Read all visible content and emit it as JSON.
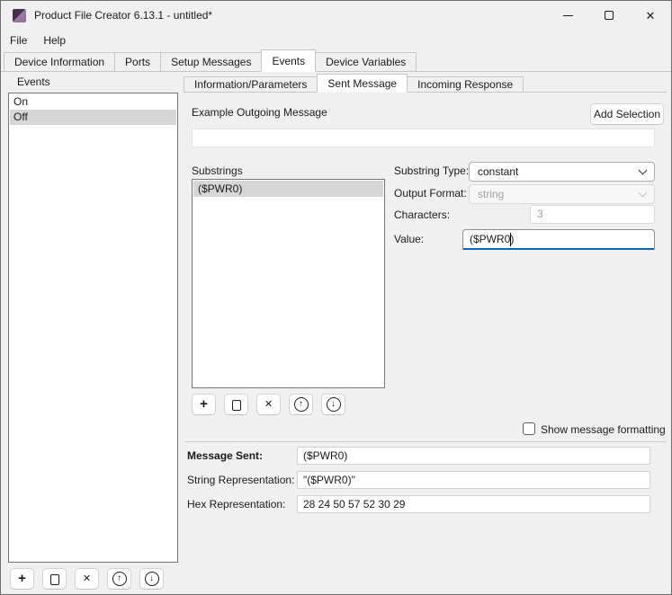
{
  "window": {
    "title": "Product File Creator 6.13.1 - untitled*"
  },
  "icons": {
    "close": "✕",
    "add": "+",
    "delete": "✕",
    "move_up": "↑",
    "move_down": "↓"
  },
  "menu": {
    "items": [
      {
        "label": "File"
      },
      {
        "label": "Help"
      }
    ]
  },
  "main_tabs": {
    "active": "Events",
    "items": [
      {
        "label": "Device Information"
      },
      {
        "label": "Ports"
      },
      {
        "label": "Setup Messages"
      },
      {
        "label": "Events"
      },
      {
        "label": "Device Variables"
      }
    ]
  },
  "events_panel": {
    "label": "Events",
    "items": [
      {
        "label": "On",
        "selected": false
      },
      {
        "label": "Off",
        "selected": true
      }
    ]
  },
  "detail_tabs": {
    "active": "Sent Message",
    "items": [
      {
        "label": "Information/Parameters"
      },
      {
        "label": "Sent Message"
      },
      {
        "label": "Incoming Response"
      }
    ]
  },
  "sent_message_tab": {
    "example_outgoing_message": {
      "label": "Example Outgoing Message",
      "value": ""
    },
    "add_selection_button": "Add Selection",
    "substrings": {
      "label": "Substrings",
      "items": [
        {
          "label": "($PWR0)",
          "selected": true
        }
      ]
    },
    "substring_type": {
      "label": "Substring Type:",
      "value": "constant",
      "enabled": true
    },
    "output_format": {
      "label": "Output Format:",
      "value": "string",
      "enabled": false
    },
    "characters": {
      "label": "Characters:",
      "value": "3",
      "enabled": false
    },
    "value_field": {
      "label": "Value:",
      "value": "($PWR0)",
      "focused": true
    },
    "show_message_formatting": {
      "label": "Show message formatting",
      "checked": false
    },
    "message_sent": {
      "label": "Message Sent:",
      "value": "($PWR0)"
    },
    "string_representation": {
      "label": "String Representation:",
      "value": "\"($PWR0)\""
    },
    "hex_representation": {
      "label": "Hex Representation:",
      "value": "28 24 50 57 52 30 29"
    }
  },
  "colors": {
    "accent_focus": "#0067c0",
    "selection_bg": "#d6d6d6",
    "window_bg": "#f0f0f0"
  }
}
